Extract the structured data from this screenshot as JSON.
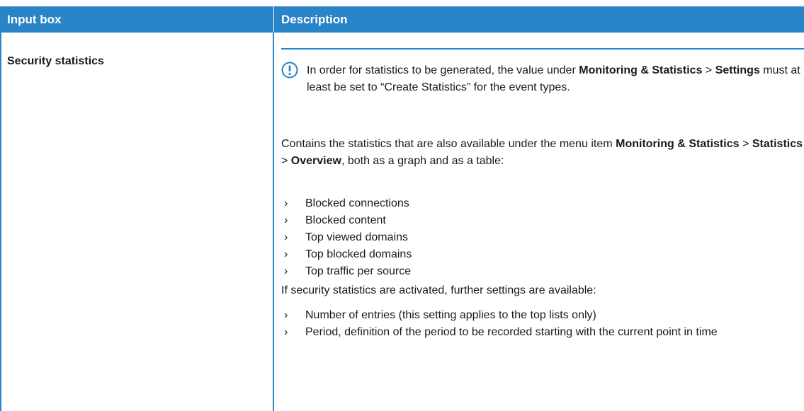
{
  "table": {
    "headers": [
      "Input box",
      "Description"
    ],
    "row": {
      "label": "Security statistics",
      "note": {
        "icon": "exclamation-circle-icon",
        "parts": [
          "In order for statistics to be generated, the value under ",
          "Monitoring & Statistics",
          " > ",
          "Settings",
          " must at least be set to “Create Statistics” for the event types."
        ]
      },
      "para1": {
        "parts": [
          "Contains the statistics that are also available under the menu item ",
          "Monitoring & Statistics",
          " > ",
          "Statistics",
          " > ",
          "Overview",
          ", both as a graph and as a table:"
        ]
      },
      "list1": [
        "Blocked connections",
        "Blocked content",
        "Top viewed domains",
        "Top blocked domains",
        "Top traffic per source"
      ],
      "para2": "If security statistics are activated, further settings are available:",
      "list2": [
        "Number of entries (this setting applies to the top lists only)",
        "Period, definition of the period to be recorded starting with the current point in time"
      ],
      "bullet_icon": "chevron-right-icon",
      "accent_color": "#2a84c8"
    }
  }
}
